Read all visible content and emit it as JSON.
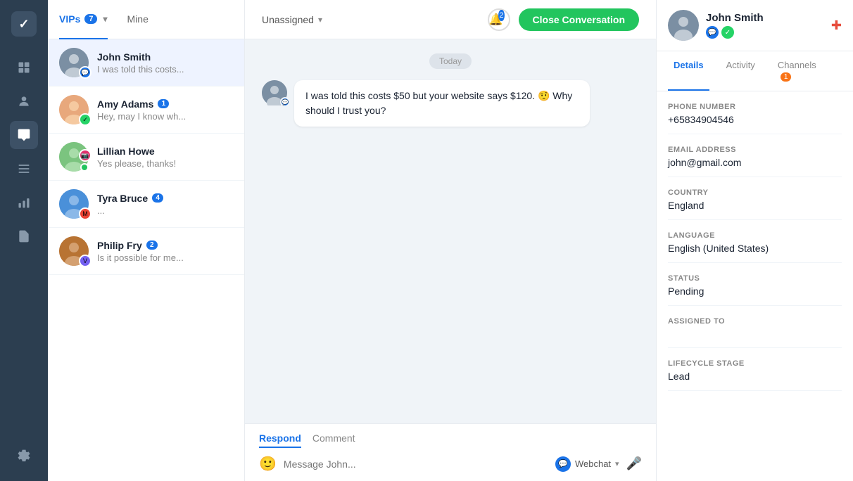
{
  "sidebar": {
    "logo": "✓",
    "items": [
      {
        "id": "dashboard",
        "icon": "⊞",
        "active": false
      },
      {
        "id": "contacts",
        "icon": "👤",
        "active": false
      },
      {
        "id": "conversations",
        "icon": "💬",
        "active": true
      },
      {
        "id": "reports",
        "icon": "📋",
        "active": false
      },
      {
        "id": "analytics",
        "icon": "📊",
        "active": false
      },
      {
        "id": "documents",
        "icon": "📄",
        "active": false
      }
    ],
    "bottom_items": [
      {
        "id": "settings",
        "icon": "⚙"
      }
    ]
  },
  "conv_list": {
    "tabs": [
      {
        "id": "vips",
        "label": "VIPs",
        "badge": "7",
        "active": true
      },
      {
        "id": "mine",
        "label": "Mine",
        "badge": null,
        "active": false
      }
    ],
    "conversations": [
      {
        "id": "john-smith",
        "name": "John Smith",
        "preview": "I was told this costs...",
        "channel": "chat",
        "unread": null,
        "active": true,
        "online": false,
        "avatar_color": "av-john"
      },
      {
        "id": "amy-adams",
        "name": "Amy Adams",
        "preview": "Hey, may I know wh...",
        "channel": "whatsapp",
        "unread": "1",
        "active": false,
        "online": false,
        "avatar_color": "av-amy"
      },
      {
        "id": "lillian-howe",
        "name": "Lillian Howe",
        "preview": "Yes please, thanks!",
        "channel": "instagram",
        "unread": null,
        "active": false,
        "online": true,
        "avatar_color": "av-lillian"
      },
      {
        "id": "tyra-bruce",
        "name": "Tyra Bruce",
        "preview": "...",
        "channel": "gmail",
        "unread": "4",
        "active": false,
        "online": false,
        "avatar_color": "av-tyra"
      },
      {
        "id": "philip-fry",
        "name": "Philip Fry",
        "preview": "Is it possible for me...",
        "channel": "viber",
        "unread": "2",
        "active": false,
        "online": false,
        "avatar_color": "av-philip"
      }
    ]
  },
  "chat": {
    "assign_label": "Unassigned",
    "alarm_count": "2",
    "close_btn_label": "Close Conversation",
    "date_label": "Today",
    "message": "I was told this costs $50 but your website says $120. 🤨 Why should I trust you?",
    "compose": {
      "tabs": [
        {
          "id": "respond",
          "label": "Respond",
          "active": true
        },
        {
          "id": "comment",
          "label": "Comment",
          "active": false
        }
      ],
      "placeholder": "Message John...",
      "channel_label": "Webchat"
    }
  },
  "right_panel": {
    "contact": {
      "name": "John Smith",
      "channels": [
        "chat",
        "whatsapp"
      ]
    },
    "tabs": [
      {
        "id": "details",
        "label": "Details",
        "active": true,
        "badge": null
      },
      {
        "id": "activity",
        "label": "Activity",
        "active": false,
        "badge": null
      },
      {
        "id": "channels",
        "label": "Channels",
        "active": false,
        "badge": "1"
      }
    ],
    "details": [
      {
        "label": "Phone Number",
        "value": "+65834904546"
      },
      {
        "label": "Email Address",
        "value": "john@gmail.com"
      },
      {
        "label": "Country",
        "value": "England"
      },
      {
        "label": "Language",
        "value": "English (United States)"
      },
      {
        "label": "Status",
        "value": "Pending"
      },
      {
        "label": "Assigned To",
        "value": ""
      },
      {
        "label": "Lifecycle Stage",
        "value": "Lead"
      }
    ]
  }
}
